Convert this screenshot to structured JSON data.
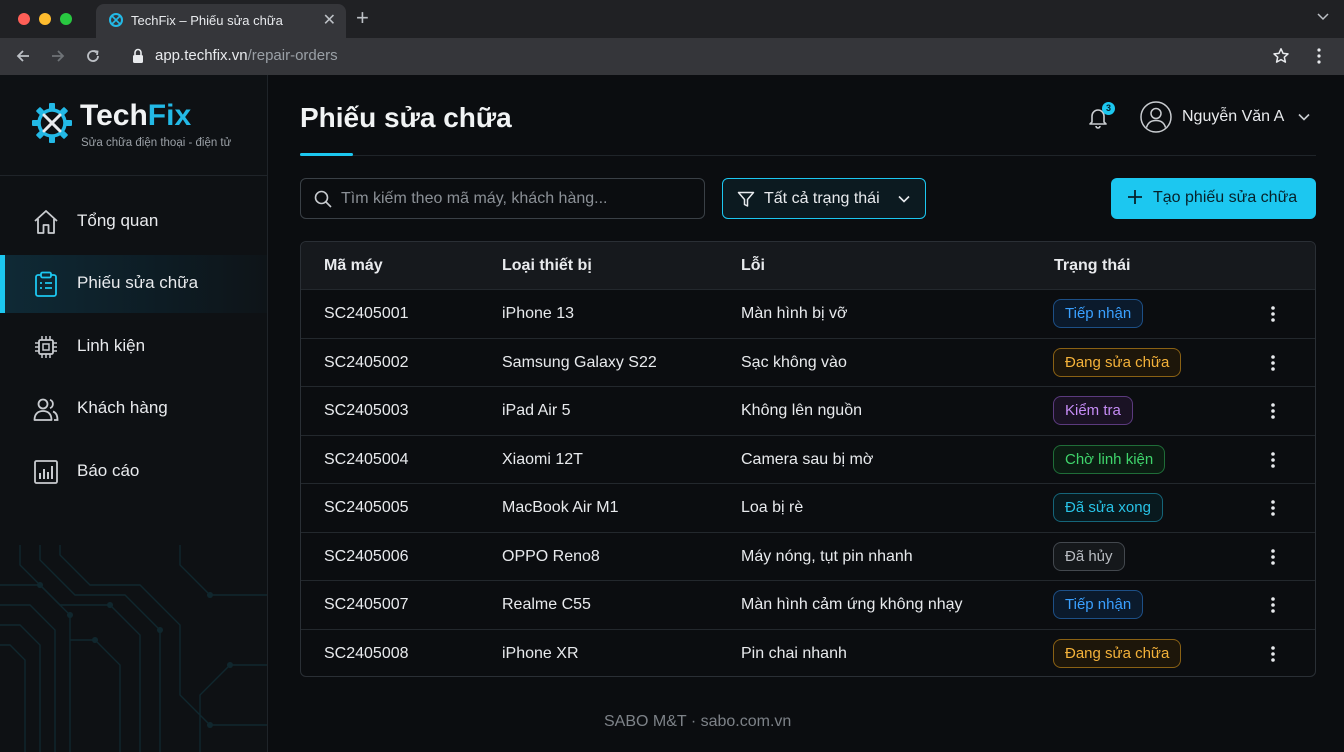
{
  "browser": {
    "tab_title": "TechFix – Phiếu sửa chữa",
    "url_domain": "app.techfix.vn",
    "url_path": "/repair-orders"
  },
  "brand": {
    "name_part1": "Tech",
    "name_part2": "Fix",
    "tagline": "Sửa chữa điện thoại - điện tử",
    "accent_color": "#1cc7f0"
  },
  "sidebar": {
    "items": [
      {
        "label": "Tổng quan",
        "icon": "home-icon",
        "active": false
      },
      {
        "label": "Phiếu sửa chữa",
        "icon": "clipboard-icon",
        "active": true
      },
      {
        "label": "Linh kiện",
        "icon": "chip-icon",
        "active": false
      },
      {
        "label": "Khách hàng",
        "icon": "users-icon",
        "active": false
      },
      {
        "label": "Báo cáo",
        "icon": "chart-icon",
        "active": false
      }
    ]
  },
  "header": {
    "title": "Phiếu sửa chữa",
    "notification_count": "3",
    "user_name": "Nguyễn Văn A"
  },
  "toolbar": {
    "search_placeholder": "Tìm kiếm theo mã máy, khách hàng...",
    "filter_label": "Tất cả trạng thái",
    "create_label": "Tạo phiếu sửa chữa"
  },
  "table": {
    "columns": [
      "Mã máy",
      "Loại thiết bị",
      "Lỗi",
      "Trạng thái"
    ],
    "rows": [
      {
        "id": "SC2405001",
        "device": "iPhone 13",
        "issue": "Màn hình bị vỡ",
        "status": "Tiếp nhận",
        "status_color": "blue"
      },
      {
        "id": "SC2405002",
        "device": "Samsung Galaxy S22",
        "issue": "Sạc không vào",
        "status": "Đang sửa chữa",
        "status_color": "orange"
      },
      {
        "id": "SC2405003",
        "device": "iPad Air 5",
        "issue": "Không lên nguồn",
        "status": "Kiểm tra",
        "status_color": "purple"
      },
      {
        "id": "SC2405004",
        "device": "Xiaomi 12T",
        "issue": "Camera sau bị mờ",
        "status": "Chờ linh kiện",
        "status_color": "green"
      },
      {
        "id": "SC2405005",
        "device": "MacBook Air M1",
        "issue": "Loa bị rè",
        "status": "Đã sửa xong",
        "status_color": "teal"
      },
      {
        "id": "SC2405006",
        "device": "OPPO Reno8",
        "issue": "Máy nóng, tụt pin nhanh",
        "status": "Đã hủy",
        "status_color": "gray"
      },
      {
        "id": "SC2405007",
        "device": "Realme C55",
        "issue": "Màn hình cảm ứng không nhạy",
        "status": "Tiếp nhận",
        "status_color": "blue"
      },
      {
        "id": "SC2405008",
        "device": "iPhone XR",
        "issue": "Pin chai nhanh",
        "status": "Đang sửa chữa",
        "status_color": "orange"
      }
    ]
  },
  "footer": {
    "text": "SABO M&T  ·  sabo.com.vn"
  }
}
